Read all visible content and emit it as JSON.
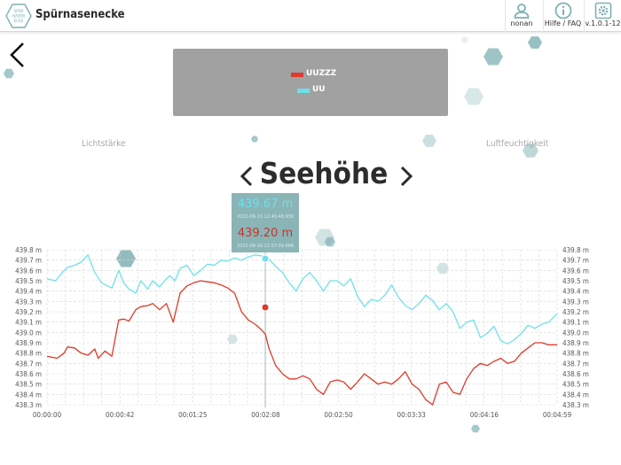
{
  "header": {
    "app_title": "Spürnasenecke",
    "logo_text": "SPÜR NASEN ECKE",
    "user_label": "nonan",
    "help_label": "Hilfe / FAQ",
    "version_label": "v.1.0.1-12"
  },
  "legend": [
    {
      "label": "UUZZZ",
      "color": "#e03a2f"
    },
    {
      "label": "UU",
      "color": "#6fe0ea"
    }
  ],
  "side_metrics": {
    "left": "Lichtstärke",
    "right": "Luftfeuchtigkeit"
  },
  "metric_title": "Seehöhe",
  "tooltip": {
    "value_1": "439.67 m",
    "time_1": "2022-09-13 12:40:48.930",
    "value_2": "439.20 m",
    "time_2": "2022-09-19 22:57:09.668"
  },
  "colors": {
    "series_1": "#6fe0ea",
    "series_2": "#dd3a2a",
    "accent": "#7fb0b3",
    "grid": "#d8d8d8"
  },
  "icons": [
    "back-arrow-icon",
    "user-icon",
    "info-icon",
    "settings-gear-icon",
    "chevron-left-icon",
    "chevron-right-icon"
  ],
  "chart_data": {
    "type": "line",
    "y_ticks": [
      "438.3 m",
      "438.4 m",
      "438.5 m",
      "438.6 m",
      "438.7 m",
      "438.8 m",
      "438.9 m",
      "439.0 m",
      "439.1 m",
      "439.2 m",
      "439.3 m",
      "439.4 m",
      "439.5 m",
      "439.6 m",
      "439.7 m",
      "439.8 m"
    ],
    "x_ticks": [
      "00:00:00",
      "00:00:42",
      "00:01:25",
      "00:02:08",
      "00:02:50",
      "00:03:33",
      "00:04:16",
      "00:04:59"
    ],
    "ylim": [
      438.3,
      439.8
    ],
    "xlim": [
      0,
      299
    ],
    "grid": true,
    "series": [
      {
        "name": "UU",
        "x": [
          0,
          5,
          9,
          12,
          16,
          20,
          24,
          28,
          32,
          38,
          42,
          45,
          48,
          52,
          55,
          59,
          62,
          66,
          70,
          72,
          75,
          78,
          82,
          86,
          90,
          94,
          98,
          102,
          106,
          110,
          114,
          118,
          122,
          126,
          130,
          134,
          138,
          142,
          146,
          150,
          154,
          158,
          162,
          166,
          170,
          174,
          178,
          182,
          186,
          190,
          194,
          198,
          202,
          206,
          210,
          214,
          218,
          222,
          226,
          230,
          234,
          238,
          242,
          246,
          250,
          254,
          258,
          262,
          266,
          270,
          274,
          278,
          282,
          286,
          290,
          294,
          299
        ],
        "y": [
          439.52,
          439.5,
          439.58,
          439.63,
          439.65,
          439.68,
          439.75,
          439.58,
          439.48,
          439.43,
          439.6,
          439.48,
          439.42,
          439.38,
          439.5,
          439.42,
          439.5,
          439.44,
          439.52,
          439.55,
          439.5,
          439.62,
          439.65,
          439.55,
          439.6,
          439.66,
          439.65,
          439.7,
          439.69,
          439.72,
          439.7,
          439.73,
          439.75,
          439.74,
          439.71,
          439.64,
          439.58,
          439.48,
          439.4,
          439.52,
          439.58,
          439.5,
          439.4,
          439.5,
          439.5,
          439.45,
          439.52,
          439.35,
          439.25,
          439.32,
          439.3,
          439.36,
          439.46,
          439.34,
          439.26,
          439.22,
          439.28,
          439.36,
          439.31,
          439.22,
          439.28,
          439.2,
          439.04,
          439.1,
          439.12,
          438.95,
          438.99,
          439.06,
          438.92,
          438.89,
          438.93,
          438.99,
          439.07,
          439.04,
          439.08,
          439.1,
          439.18
        ]
      },
      {
        "name": "UUZZZ",
        "x": [
          0,
          6,
          10,
          12,
          16,
          20,
          24,
          28,
          30,
          34,
          38,
          42,
          45,
          48,
          52,
          55,
          59,
          62,
          66,
          70,
          74,
          78,
          82,
          86,
          90,
          94,
          98,
          102,
          106,
          110,
          114,
          118,
          122,
          124,
          126,
          128,
          130,
          134,
          138,
          142,
          146,
          150,
          154,
          158,
          162,
          166,
          170,
          174,
          178,
          182,
          186,
          190,
          194,
          198,
          202,
          206,
          210,
          214,
          218,
          222,
          226,
          230,
          234,
          238,
          242,
          246,
          250,
          254,
          258,
          262,
          266,
          270,
          274,
          278,
          282,
          286,
          290,
          294,
          299
        ],
        "y": [
          438.77,
          438.75,
          438.8,
          438.86,
          438.85,
          438.8,
          438.78,
          438.84,
          438.75,
          438.82,
          438.77,
          439.12,
          439.13,
          439.11,
          439.22,
          439.25,
          439.26,
          439.28,
          439.22,
          439.28,
          439.1,
          439.38,
          439.45,
          439.48,
          439.5,
          439.49,
          439.48,
          439.46,
          439.43,
          439.38,
          439.2,
          439.12,
          439.08,
          439.05,
          439.02,
          438.98,
          438.85,
          438.68,
          438.6,
          438.55,
          438.55,
          438.58,
          438.55,
          438.45,
          438.4,
          438.52,
          438.54,
          438.52,
          438.45,
          438.52,
          438.6,
          438.55,
          438.5,
          438.52,
          438.5,
          438.55,
          438.62,
          438.5,
          438.45,
          438.35,
          438.3,
          438.5,
          438.52,
          438.42,
          438.4,
          438.55,
          438.65,
          438.7,
          438.68,
          438.72,
          438.75,
          438.7,
          438.72,
          438.8,
          438.85,
          438.9,
          438.9,
          438.88,
          438.88
        ]
      }
    ]
  }
}
